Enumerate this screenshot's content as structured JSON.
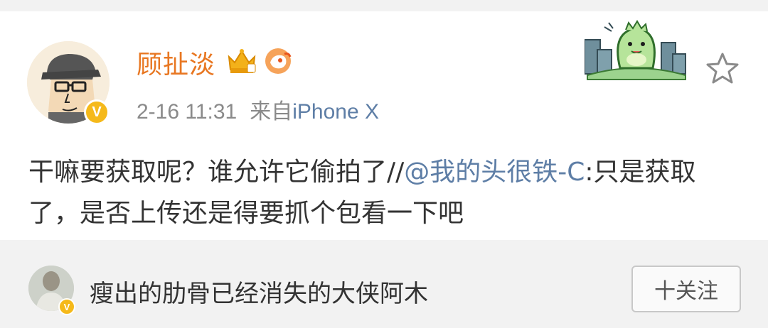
{
  "post": {
    "username": "顾扯淡",
    "verified_badge": "V",
    "time": "2-16 11:31",
    "source_label": "来自",
    "source_device": "iPhone X",
    "content_text": "干嘛要获取呢？谁允许它偷拍了",
    "content_slashes": "//",
    "mention": "@我的头很铁-C",
    "content_rest": ":只是获取了，是否上传还是得要抓个包看一下吧",
    "icons": [
      "avatar",
      "verified-badge-icon",
      "crown-icon",
      "weibo-bird-icon",
      "dinosaur-sticker",
      "star-icon"
    ]
  },
  "suggestion": {
    "name": "瘦出的肋骨已经消失的大侠阿木",
    "verified_badge": "V",
    "follow_label": "十关注"
  },
  "colors": {
    "username": "#e87722",
    "link": "#5e7ea6",
    "meta": "#8a8a8a",
    "badge": "#f5b91a"
  }
}
